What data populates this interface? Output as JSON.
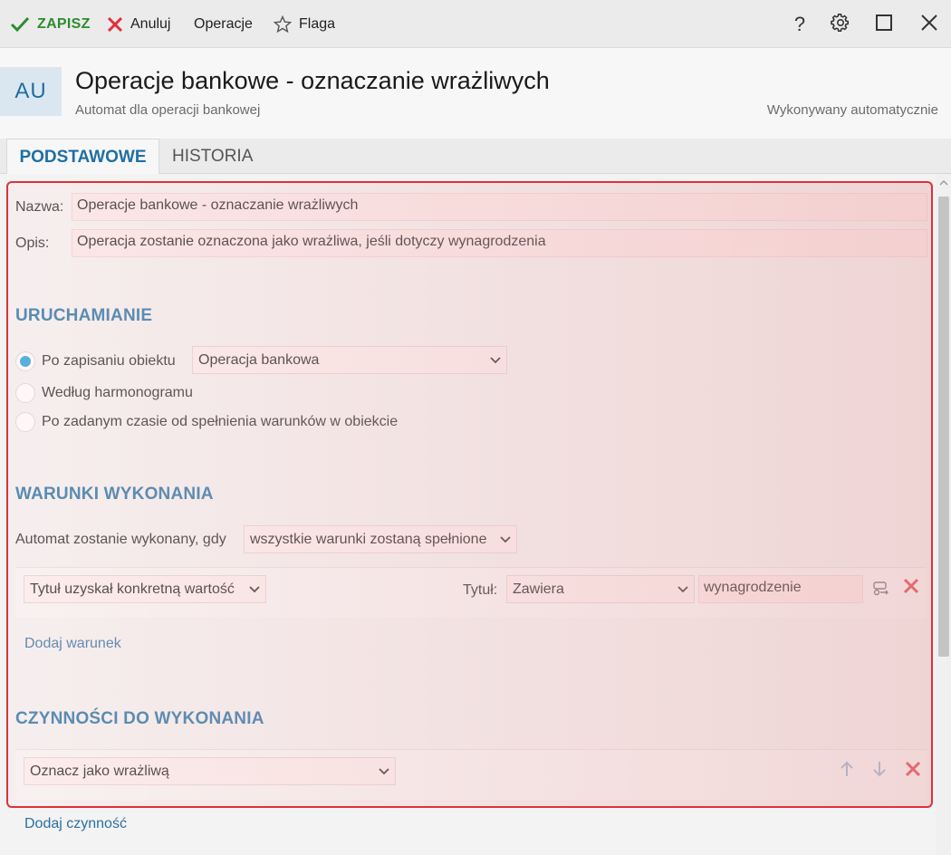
{
  "toolbar": {
    "save_label": "ZAPISZ",
    "cancel_label": "Anuluj",
    "operations_label": "Operacje",
    "flag_label": "Flaga",
    "help_label": "?"
  },
  "header": {
    "avatar": "AU",
    "title": "Operacje bankowe - oznaczanie wrażliwych",
    "subtitle": "Automat dla operacji bankowej",
    "execution_mode": "Wykonywany automatycznie"
  },
  "tabs": [
    {
      "label": "PODSTAWOWE",
      "active": true
    },
    {
      "label": "HISTORIA",
      "active": false
    }
  ],
  "form": {
    "name_label": "Nazwa:",
    "name_value": "Operacje bankowe - oznaczanie wrażliwych",
    "description_label": "Opis:",
    "description_value": "Operacja zostanie oznaczona jako wrażliwa, jeśli dotyczy wynagrodzenia"
  },
  "trigger": {
    "section_title": "URUCHAMIANIE",
    "options": [
      {
        "label": "Po zapisaniu obiektu",
        "selected": true
      },
      {
        "label": "Według harmonogramu",
        "selected": false
      },
      {
        "label": "Po zadanym czasie od spełnienia warunków w obiekcie",
        "selected": false
      }
    ],
    "object_select": "Operacja bankowa"
  },
  "conditions": {
    "section_title": "WARUNKI WYKONANIA",
    "intro_label": "Automat zostanie wykonany, gdy",
    "mode_select": "wszystkie warunki zostaną spełnione",
    "items": [
      {
        "type_select": "Tytuł uzyskał konkretną wartość",
        "field_label": "Tytuł:",
        "operator_select": "Zawiera",
        "value": "wynagrodzenie"
      }
    ],
    "add_link": "Dodaj warunek"
  },
  "actions": {
    "section_title": "CZYNNOŚCI DO WYKONANIA",
    "items": [
      {
        "action_select": "Oznacz jako wrażliwą"
      }
    ],
    "add_link": "Dodaj czynność"
  },
  "colors": {
    "accent": "#1f6fa3",
    "save_green": "#2e8b2e",
    "delete_red": "#e0303a",
    "radio_blue": "#1ea0dd"
  }
}
